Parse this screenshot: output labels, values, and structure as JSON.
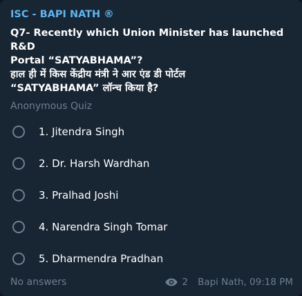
{
  "message": {
    "sender": "ISC - BAPI NATH ®",
    "question_line1": "Q7- Recently which Union Minister has launched R&D",
    "question_line2": "Portal “SATYABHAMA”?",
    "question_line3": "हाल ही में किस केंद्रीय मंत्री ने आर एंड डी पोर्टल",
    "question_line4": "“SATYABHAMA” लॉन्च किया है?",
    "quiz_type": "Anonymous Quiz",
    "options": [
      {
        "label": "1. Jitendra Singh"
      },
      {
        "label": "2. Dr. Harsh Wardhan"
      },
      {
        "label": "3. Pralhad Joshi"
      },
      {
        "label": "4. Narendra Singh Tomar"
      },
      {
        "label": "5. Dharmendra Pradhan"
      }
    ],
    "footer": {
      "results": "No answers",
      "views_icon": "eye-icon",
      "views": "2",
      "author_time": "Bapi Nath, 09:18 PM"
    }
  },
  "colors": {
    "background": "#0e1621",
    "bubble": "#182533",
    "sender": "#5fb5f0",
    "text": "#ffffff",
    "muted": "#6d7f8f",
    "radio": "#6e8191"
  }
}
